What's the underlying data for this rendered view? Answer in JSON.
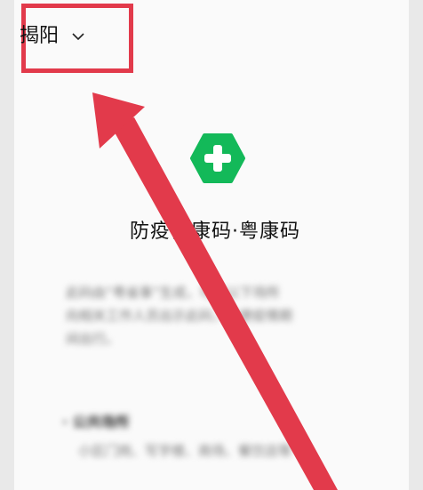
{
  "header": {
    "city_label": "揭阳",
    "chevron_icon": "chevron-down-icon"
  },
  "app": {
    "logo_icon": "green-hexagon-plus-icon",
    "title": "防疫健康码·粤康码",
    "brand_green": "#13b959"
  },
  "description": {
    "line1": "此码由“粤省事”生成，可在以下场所",
    "line2": "向相关工作人员出示此码，方便疫情期",
    "line3": "间出行。"
  },
  "section": {
    "heading": "· 公共场所",
    "line1": "小区门岗、写字楼、商场、餐饮店等"
  },
  "annotation": {
    "color": "#e23a4b"
  }
}
